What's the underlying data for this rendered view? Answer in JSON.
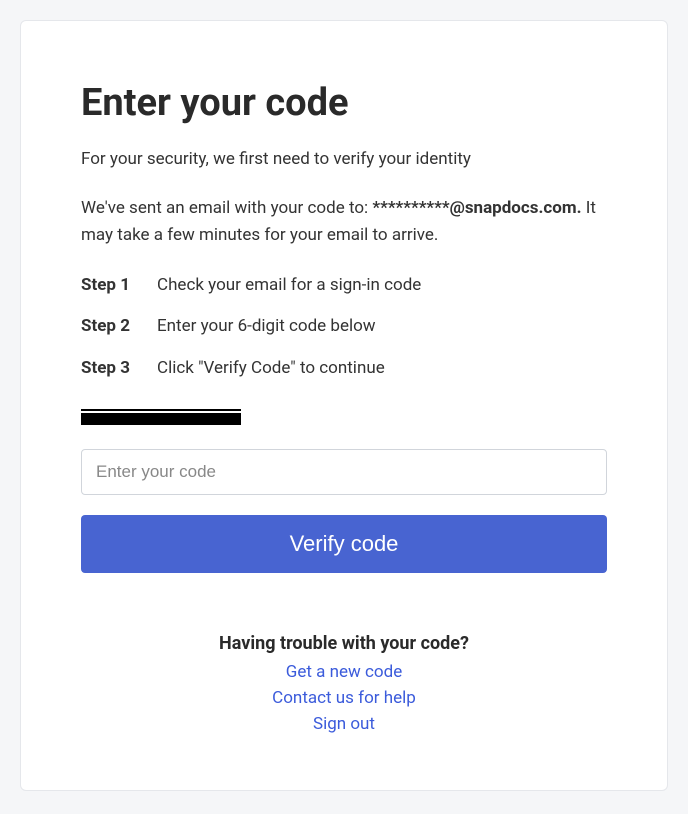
{
  "title": "Enter your code",
  "subtitle": "For your security, we first need to verify your identity",
  "email_info": {
    "prefix": "We've sent an email with your code to: ",
    "email": "**********@snapdocs.com.",
    "suffix": " It may take a few minutes for your email to arrive."
  },
  "steps": [
    {
      "label": "Step 1",
      "text": "Check your email for a sign-in code"
    },
    {
      "label": "Step 2",
      "text": "Enter your 6-digit code below"
    },
    {
      "label": "Step 3",
      "text": "Click \"Verify Code\" to continue"
    }
  ],
  "input": {
    "placeholder": "Enter your code",
    "value": ""
  },
  "verify_button": "Verify code",
  "help": {
    "title": "Having trouble with your code?",
    "links": [
      "Get a new code",
      "Contact us for help",
      "Sign out"
    ]
  }
}
